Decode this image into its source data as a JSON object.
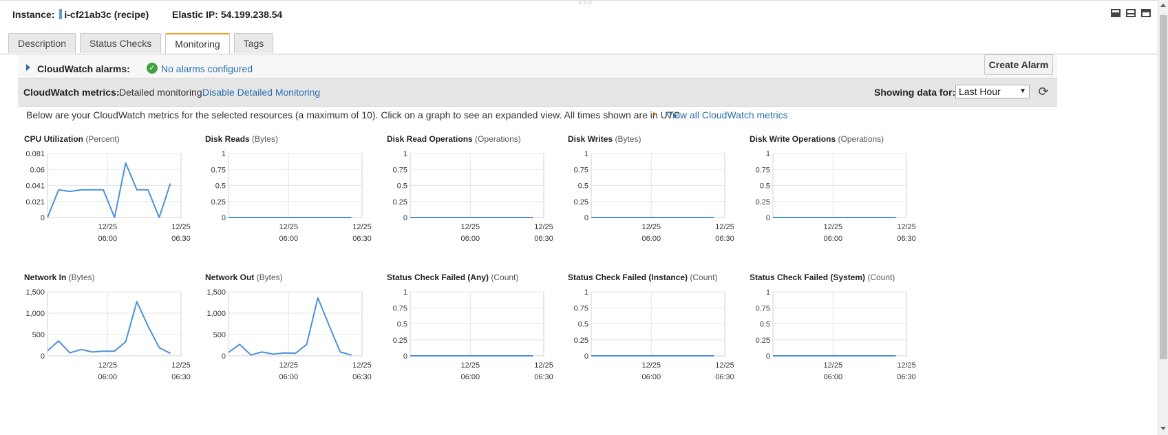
{
  "header": {
    "instance_label": "Instance:",
    "instance_id": "i-cf21ab3c (recipe)",
    "eip_label": "Elastic IP:",
    "eip_value": "54.199.238.54"
  },
  "tabs": [
    "Description",
    "Status Checks",
    "Monitoring",
    "Tags"
  ],
  "alarms": {
    "title": "CloudWatch alarms:",
    "status": "No alarms configured",
    "create_button": "Create Alarm"
  },
  "metrics": {
    "title": "CloudWatch metrics:",
    "description": "Detailed monitoring.",
    "disable_link": "Disable Detailed Monitoring",
    "showing_label": "Showing data for:",
    "range_value": "Last Hour"
  },
  "intro": {
    "text": "Below are your CloudWatch metrics for the selected resources (a maximum of 10). Click on a graph to see an expanded view. All times shown are in UTC.",
    "link": "View all CloudWatch metrics"
  },
  "icons": {
    "window_controls": [
      "panel-bottom-icon",
      "panel-middle-icon",
      "panel-top-icon"
    ],
    "refresh": "refresh-icon",
    "alarm_status": "check-icon"
  },
  "colors": {
    "line": "#4a90d9",
    "link": "#2a6fb0",
    "active_tab": "#f39c12"
  },
  "x_ticks": [
    {
      "date": "12/25",
      "time": "06:00"
    },
    {
      "date": "12/25",
      "time": "06:30"
    }
  ],
  "chart_data": [
    {
      "type": "line",
      "title": "CPU Utilization",
      "unit": "(Percent)",
      "yticks": [
        "0.081",
        "0.06",
        "0.041",
        "0.021",
        "0"
      ],
      "ylim": [
        0,
        0.081
      ],
      "values": [
        0,
        0.035,
        0.033,
        0.035,
        0.035,
        0.035,
        0,
        0.069,
        0.035,
        0.035,
        0,
        0.043
      ]
    },
    {
      "type": "line",
      "title": "Disk Reads",
      "unit": "(Bytes)",
      "yticks": [
        "1",
        "0.75",
        "0.5",
        "0.25",
        "0"
      ],
      "ylim": [
        0,
        1
      ],
      "values": [
        0,
        0,
        0,
        0,
        0,
        0,
        0,
        0,
        0,
        0,
        0,
        0
      ]
    },
    {
      "type": "line",
      "title": "Disk Read Operations",
      "unit": "(Operations)",
      "yticks": [
        "1",
        "0.75",
        "0.5",
        "0.25",
        "0"
      ],
      "ylim": [
        0,
        1
      ],
      "values": [
        0,
        0,
        0,
        0,
        0,
        0,
        0,
        0,
        0,
        0,
        0,
        0
      ]
    },
    {
      "type": "line",
      "title": "Disk Writes",
      "unit": "(Bytes)",
      "yticks": [
        "1",
        "0.75",
        "0.5",
        "0.25",
        "0"
      ],
      "ylim": [
        0,
        1
      ],
      "values": [
        0,
        0,
        0,
        0,
        0,
        0,
        0,
        0,
        0,
        0,
        0,
        0
      ]
    },
    {
      "type": "line",
      "title": "Disk Write Operations",
      "unit": "(Operations)",
      "yticks": [
        "1",
        "0.75",
        "0.5",
        "0.25",
        "0"
      ],
      "ylim": [
        0,
        1
      ],
      "values": [
        0,
        0,
        0,
        0,
        0,
        0,
        0,
        0,
        0,
        0,
        0,
        0
      ]
    },
    {
      "type": "line",
      "title": "Network In",
      "unit": "(Bytes)",
      "yticks": [
        "1,500",
        "1,000",
        "500",
        "0"
      ],
      "ylim": [
        0,
        1500
      ],
      "values": [
        120,
        350,
        70,
        150,
        90,
        110,
        110,
        330,
        1270,
        700,
        190,
        60
      ]
    },
    {
      "type": "line",
      "title": "Network Out",
      "unit": "(Bytes)",
      "yticks": [
        "1,500",
        "1,000",
        "500",
        "0"
      ],
      "ylim": [
        0,
        1500
      ],
      "values": [
        80,
        270,
        20,
        90,
        40,
        70,
        60,
        270,
        1360,
        720,
        90,
        20
      ]
    },
    {
      "type": "line",
      "title": "Status Check Failed (Any)",
      "unit": "(Count)",
      "yticks": [
        "1",
        "0.75",
        "0.5",
        "0.25",
        "0"
      ],
      "ylim": [
        0,
        1
      ],
      "values": [
        0,
        0,
        0,
        0,
        0,
        0,
        0,
        0,
        0,
        0,
        0,
        0
      ]
    },
    {
      "type": "line",
      "title": "Status Check Failed (Instance)",
      "unit": "(Count)",
      "yticks": [
        "1",
        "0.75",
        "0.5",
        "0.25",
        "0"
      ],
      "ylim": [
        0,
        1
      ],
      "values": [
        0,
        0,
        0,
        0,
        0,
        0,
        0,
        0,
        0,
        0,
        0,
        0
      ]
    },
    {
      "type": "line",
      "title": "Status Check Failed (System)",
      "unit": "(Count)",
      "yticks": [
        "1",
        "0.75",
        "0.5",
        "0.25",
        "0"
      ],
      "ylim": [
        0,
        1
      ],
      "values": [
        0,
        0,
        0,
        0,
        0,
        0,
        0,
        0,
        0,
        0,
        0,
        0
      ]
    }
  ]
}
